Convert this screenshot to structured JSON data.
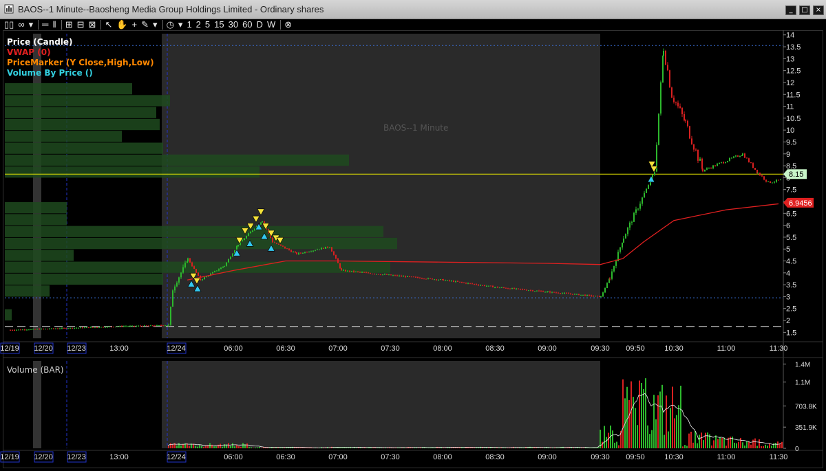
{
  "window": {
    "title": "BAOS--1 Minute--Baosheng Media Group Holdings Limited - Ordinary shares",
    "buttons": [
      "_",
      "□",
      "×"
    ]
  },
  "toolbar": {
    "items": [
      {
        "name": "chart-type-icon",
        "label": "▯▯"
      },
      {
        "name": "link-icon",
        "label": "∞"
      },
      {
        "name": "dropdown-icon",
        "label": "▾"
      },
      {
        "name": "lines-icon",
        "label": "═"
      },
      {
        "name": "pause-icon",
        "label": "‖"
      },
      {
        "name": "grid-icon",
        "label": "⊞"
      },
      {
        "name": "layout-icon",
        "label": "⊟"
      },
      {
        "name": "remove-icon",
        "label": "⊠"
      },
      {
        "name": "pointer-icon",
        "label": "↖"
      },
      {
        "name": "hand-icon",
        "label": "✋"
      },
      {
        "name": "crosshair-icon",
        "label": "+"
      },
      {
        "name": "pencil-icon",
        "label": "✎"
      },
      {
        "name": "dropdown-icon-2",
        "label": "▾"
      },
      {
        "name": "clock-icon",
        "label": "◷"
      },
      {
        "name": "dropdown-icon-3",
        "label": "▾"
      }
    ],
    "intervals": [
      "1",
      "2",
      "5",
      "15",
      "30",
      "60",
      "D",
      "W"
    ],
    "cancel_label": "⊗"
  },
  "legend": {
    "price": "Price (Candle)",
    "vwap": "VWAP (0)",
    "marker": "PriceMarker (Y Close,High,Low)",
    "vbp": "Volume By Price ()"
  },
  "watermark": "BAOS--1 Minute",
  "volume_title": "Volume (BAR)",
  "colors": {
    "up": "#2db82d",
    "down": "#d92020",
    "vwap": "#e02020",
    "price_line": "#e6e600",
    "vbp": "#1f4a1f",
    "premarket_bg": "#2a2a2a",
    "price_label_bg": "#c8f5c8",
    "vwap_label_bg": "#e02020"
  },
  "chart_data": {
    "type": "candlestick",
    "price_axis": {
      "ticks": [
        "14",
        "13.5",
        "13",
        "12.5",
        "12",
        "11.5",
        "11",
        "10.5",
        "10",
        "9.5",
        "9",
        "8.5",
        "8",
        "7.5",
        "7",
        "6.5",
        "6",
        "5.5",
        "5",
        "4.5",
        "4",
        "3.5",
        "3",
        "2.5",
        "2",
        "1.5"
      ],
      "range": [
        1.25,
        14.05
      ]
    },
    "time_axis": {
      "labels": [
        "12/19",
        "12/20",
        "12/23",
        "13:00",
        "12/24",
        "06:00",
        "06:30",
        "07:00",
        "07:30",
        "08:00",
        "08:30",
        "09:00",
        "09:30",
        "09:50",
        "10:30",
        "11:00",
        "11:30"
      ]
    },
    "current_price_label": "8.15",
    "vwap_label": "6.9456",
    "volume_axis": {
      "ticks": [
        "1.4M",
        "1.1M",
        "703.8K",
        "351.9K",
        "0"
      ]
    },
    "price_path": [
      {
        "t": "12/19",
        "p": 1.6
      },
      {
        "t": "13:00",
        "p": 1.75
      },
      {
        "t": "12/24",
        "p": 1.8
      },
      {
        "t": "12/24",
        "p": 3.3
      },
      {
        "t": "12/24",
        "p": 4.6
      },
      {
        "t": "12/24",
        "p": 3.7
      },
      {
        "t": "06:00",
        "p": 4.3
      },
      {
        "t": "06:00",
        "p": 5.2
      },
      {
        "t": "06:30",
        "p": 6.2
      },
      {
        "t": "06:30",
        "p": 5.3
      },
      {
        "t": "06:30",
        "p": 4.8
      },
      {
        "t": "07:00",
        "p": 5.1
      },
      {
        "t": "07:00",
        "p": 4.1
      },
      {
        "t": "07:30",
        "p": 3.9
      },
      {
        "t": "08:00",
        "p": 3.7
      },
      {
        "t": "08:30",
        "p": 3.4
      },
      {
        "t": "09:00",
        "p": 3.2
      },
      {
        "t": "09:30",
        "p": 3.0
      },
      {
        "t": "09:30",
        "p": 3.8
      },
      {
        "t": "09:50",
        "p": 5.5
      },
      {
        "t": "09:50",
        "p": 7.5
      },
      {
        "t": "09:50",
        "p": 8.3
      },
      {
        "t": "10:30",
        "p": 13.5
      },
      {
        "t": "10:30",
        "p": 11.5
      },
      {
        "t": "10:30",
        "p": 10.3
      },
      {
        "t": "11:00",
        "p": 8.3
      },
      {
        "t": "11:00",
        "p": 9.0
      },
      {
        "t": "11:00",
        "p": 8.2
      },
      {
        "t": "11:30",
        "p": 7.8
      },
      {
        "t": "11:30",
        "p": 7.9
      }
    ],
    "vwap_path": [
      {
        "t": "12/24",
        "p": 3.7
      },
      {
        "t": "06:00",
        "p": 4.1
      },
      {
        "t": "06:30",
        "p": 4.5
      },
      {
        "t": "07:00",
        "p": 4.5
      },
      {
        "t": "08:00",
        "p": 4.45
      },
      {
        "t": "09:00",
        "p": 4.4
      },
      {
        "t": "09:30",
        "p": 4.35
      },
      {
        "t": "09:50",
        "p": 4.6
      },
      {
        "t": "09:50",
        "p": 5.3
      },
      {
        "t": "10:30",
        "p": 6.2
      },
      {
        "t": "11:00",
        "p": 6.65
      },
      {
        "t": "11:30",
        "p": 6.9
      }
    ],
    "volume_by_price": [
      {
        "price": 11.5,
        "size": 0.37
      },
      {
        "price": 11.0,
        "size": 0.48
      },
      {
        "price": 10.5,
        "size": 0.44
      },
      {
        "price": 10.0,
        "size": 0.45
      },
      {
        "price": 9.5,
        "size": 0.34
      },
      {
        "price": 9.0,
        "size": 0.46
      },
      {
        "price": 8.5,
        "size": 1.0
      },
      {
        "price": 8.0,
        "size": 0.74
      },
      {
        "price": 6.5,
        "size": 0.18
      },
      {
        "price": 6.0,
        "size": 0.18
      },
      {
        "price": 5.5,
        "size": 1.1
      },
      {
        "price": 5.0,
        "size": 1.14
      },
      {
        "price": 4.5,
        "size": 0.2
      },
      {
        "price": 4.0,
        "size": 1.12
      },
      {
        "price": 3.5,
        "size": 0.46
      },
      {
        "price": 3.0,
        "size": 0.13
      },
      {
        "price": 2.0,
        "size": 0.02
      }
    ]
  }
}
